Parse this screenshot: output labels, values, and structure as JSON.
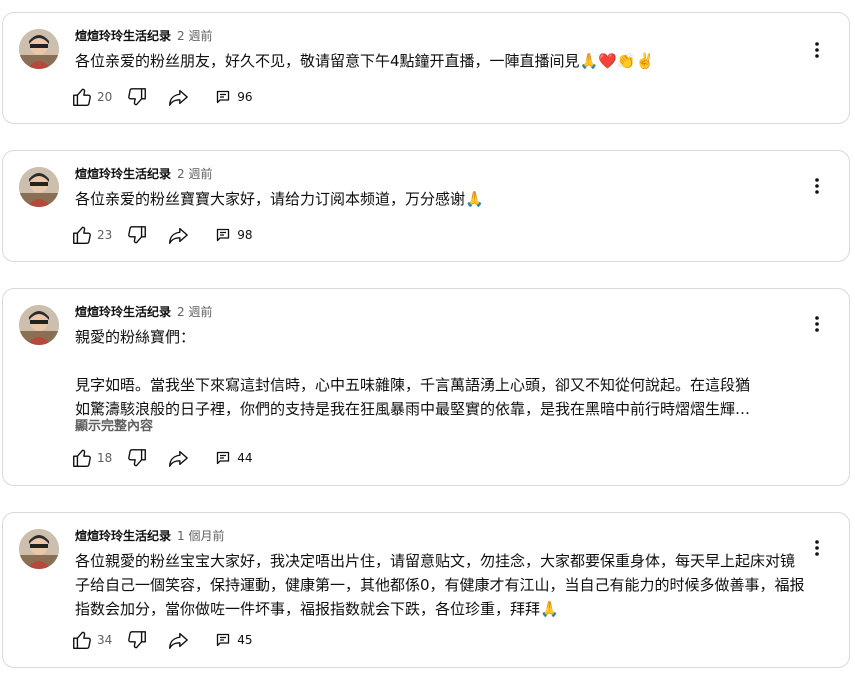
{
  "posts": [
    {
      "author": "煊煊玲玲生活纪录",
      "time": "2 週前",
      "paragraphs": [
        "各位亲爱的粉丝朋友，好久不见，敬请留意下午4點鐘开直播，一陣直播间見🙏❤️👏✌️"
      ],
      "likes": "20",
      "comments": "96"
    },
    {
      "author": "煊煊玲玲生活纪录",
      "time": "2 週前",
      "paragraphs": [
        "各位亲爱的粉丝寶寶大家好，请给力订阅本频道，万分感谢🙏"
      ],
      "likes": "23",
      "comments": "98"
    },
    {
      "author": "煊煊玲玲生活纪录",
      "time": "2 週前",
      "paragraphs": [
        "親愛的粉絲寶們：",
        "",
        "見字如晤。當我坐下來寫這封信時，心中五味雜陳，千言萬語湧上心頭，卻又不知從何說起。在這段猶",
        "如驚濤駭浪般的日子裡，你們的支持是我在狂風暴雨中最堅實的依靠，是我在黑暗中前行時熠熠生輝…"
      ],
      "show_more": "顯示完整內容",
      "likes": "18",
      "comments": "44"
    },
    {
      "author": "煊煊玲玲生活纪录",
      "time": "1 個月前",
      "paragraphs": [
        "各位親愛的粉丝宝宝大家好，我决定唔出片住，请留意贴文，勿挂念，大家都要保重身体，每天早上起床对镜子给自己一個笑容，保持運動，健康第一，其他都係0，有健康才有江山，当自己有能力的时候多做善事，福报指数会加分，當你做咗一件坏事，福报指数就会下跌，各位珍重，拜拜🙏"
      ],
      "likes": "34",
      "comments": "45"
    }
  ],
  "icons": {
    "like": "thumbs-up-icon",
    "dislike": "thumbs-down-icon",
    "share": "share-arrow-icon",
    "comment": "comment-icon",
    "more": "more-vertical-icon"
  },
  "colors": {
    "text": "#0f0f0f",
    "secondary": "#606060",
    "border": "#d9d9d9"
  }
}
